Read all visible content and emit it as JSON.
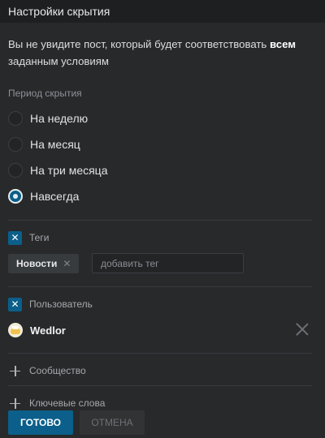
{
  "header": {
    "title": "Настройки скрытия"
  },
  "description": {
    "text": "Вы не увидите пост, который будет соответствовать",
    "bold": "всем",
    "text_end": "заданным условиям"
  },
  "period": {
    "label": "Период скрытия",
    "options": [
      {
        "label": "На неделю",
        "checked": false
      },
      {
        "label": "На месяц",
        "checked": false
      },
      {
        "label": "На три месяца",
        "checked": false
      },
      {
        "label": "Навсегда",
        "checked": true
      }
    ]
  },
  "tags": {
    "label": "Теги",
    "checked": true,
    "chip": "Новости",
    "chip_remove_icon": "close-icon",
    "input_placeholder": "добавить тег",
    "check_icon": "x-mark-icon"
  },
  "user": {
    "label": "Пользователь",
    "checked": true,
    "name": "Wedlor",
    "remove_icon": "close-icon"
  },
  "community": {
    "label": "Сообщество",
    "icon": "plus-icon"
  },
  "keywords": {
    "label": "Ключевые слова",
    "icon": "plus-icon"
  },
  "actions": {
    "ok_label": "ГОТОВО",
    "cancel_label": "ОТМЕНА"
  },
  "colors": {
    "accent": "#0b5f8a",
    "background": "#27292b",
    "header": "#1e1f21"
  }
}
